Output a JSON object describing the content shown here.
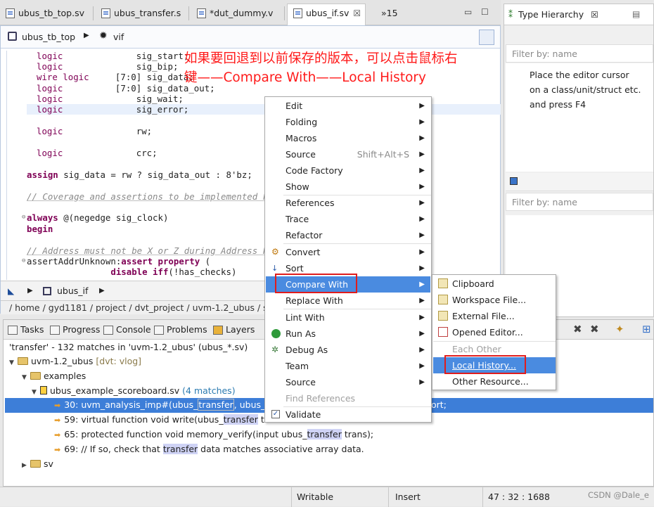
{
  "editor_tabs": [
    {
      "label": "ubus_tb_top.sv"
    },
    {
      "label": "ubus_transfer.s"
    },
    {
      "label": "*dut_dummy.v"
    },
    {
      "label": "ubus_if.sv"
    },
    {
      "label": "»15"
    }
  ],
  "breadcrumb": {
    "file": "ubus_tb_top",
    "item": "vif"
  },
  "code_lines": [
    {
      "kw": "logic",
      "rest": "              sig_start;"
    },
    {
      "kw": "logic",
      "rest": "              sig_bip;"
    },
    {
      "kw": "wire logic",
      "rest": "     [7:0] sig_data;"
    },
    {
      "kw": "logic",
      "rest": "          [7:0] sig_data_out;"
    },
    {
      "kw": "logic",
      "rest": "              sig_wait;"
    },
    {
      "kw": "logic",
      "rest": "              sig_error;"
    },
    {
      "kw": "logic",
      "rest": "              rw;"
    },
    {
      "kw": "logic",
      "rest": "              crc;"
    },
    {
      "kw": "assign",
      "rest": " sig_data = rw ? sig_data_out : 8'bz;"
    },
    {
      "comment": "// Coverage and assertions to be implemented he"
    },
    {
      "kw": "always",
      "rest": " @(negedge sig_clock)"
    },
    {
      "kw": "begin",
      "rest": ""
    },
    {
      "comment": "// Address must not be X or Z during Address Ph"
    },
    {
      "label": "assertAddrUnknown:",
      "kw": "assert property",
      "rest": " ("
    },
    {
      "indent": "                ",
      "kw": "disable iff",
      "rest": "(!has_checks)"
    }
  ],
  "editor_bottom_crumb": "ubus_if",
  "path_bar": "/ home / gyd1181 / project / dvt_project / uvm-1.2_ubus / sv /",
  "annotation": {
    "line1": "如果要回退到以前保存的版本，可以点击鼠标右",
    "line2": "键——Compare With——Local History"
  },
  "type_hierarchy": {
    "title": "Type Hierarchy",
    "filter_placeholder": "Filter by: name",
    "hint": [
      "Place the editor cursor",
      "on a class/unit/struct etc.",
      "and press F4"
    ],
    "filter2_placeholder": "Filter by: name"
  },
  "bottom_tabs": [
    "Tasks",
    "Progress",
    "Console",
    "Problems",
    "Layers"
  ],
  "search": {
    "summary": "'transfer' - 132 matches in 'uvm-1.2_ubus' (ubus_*.sv)",
    "project": "uvm-1.2_ubus",
    "project_tag": "[dvt: vlog]",
    "folder": "examples",
    "file": "ubus_example_scoreboard.sv",
    "file_matches": "(4 matches)",
    "results": [
      {
        "line": "30:",
        "pre": " uvm_analysis_imp#(ubus_",
        "match": "transfer",
        "post": ", ubus_ex",
        "tail": "ort;"
      },
      {
        "line": "59:",
        "pre": " virtual function void write(ubus_",
        "match": "transfer",
        "post": " tran",
        "tail": ""
      },
      {
        "line": "65:",
        "pre": " protected function void memory_verify(input ubus_",
        "match": "transfer",
        "post": " trans);",
        "tail": ""
      },
      {
        "line": "69:",
        "pre": " // If so, check that ",
        "match": "transfer",
        "post": " data matches associative array data.",
        "tail": ""
      }
    ],
    "folder2": "sv"
  },
  "status": {
    "mode": "Writable",
    "insert": "Insert",
    "position": "47 : 32 : 1688"
  },
  "context_menu": [
    {
      "label": "Edit",
      "arrow": true
    },
    {
      "label": "Folding",
      "arrow": true
    },
    {
      "label": "Macros",
      "arrow": true
    },
    {
      "label": "Source",
      "shortcut": "Shift+Alt+S",
      "arrow": true
    },
    {
      "label": "Code Factory",
      "arrow": true
    },
    {
      "label": "Show",
      "arrow": true
    },
    {
      "label": "References",
      "arrow": true
    },
    {
      "label": "Trace",
      "arrow": true
    },
    {
      "label": "Refactor",
      "arrow": true
    },
    {
      "label": "Convert",
      "arrow": true,
      "icon": "convert-icon"
    },
    {
      "label": "Sort",
      "arrow": true,
      "icon": "sort-icon"
    },
    {
      "label": "Compare With",
      "arrow": true,
      "active": true
    },
    {
      "label": "Replace With",
      "arrow": true
    },
    {
      "label": "Lint With",
      "arrow": true
    },
    {
      "label": "Run As",
      "arrow": true,
      "icon": "run-icon"
    },
    {
      "label": "Debug As",
      "arrow": true,
      "icon": "debug-icon"
    },
    {
      "label": "Team",
      "arrow": true
    },
    {
      "label": "Source",
      "arrow": true
    },
    {
      "label": "Find References",
      "disabled": true
    },
    {
      "label": "Validate",
      "icon": "check-icon"
    }
  ],
  "submenu": [
    {
      "label": "Clipboard"
    },
    {
      "label": "Workspace File..."
    },
    {
      "label": "External File..."
    },
    {
      "label": "Opened Editor..."
    },
    {
      "label": "Each Other",
      "disabled": true
    },
    {
      "label": "Local History...",
      "active": true
    },
    {
      "label": "Other Resource..."
    }
  ],
  "watermark": "CSDN @Dale_e",
  "colors": {
    "selection": "#3d7ed8",
    "menu_active": "#4a8be0",
    "annotation": "#ff1a1a",
    "keyword": "#7f0055"
  }
}
